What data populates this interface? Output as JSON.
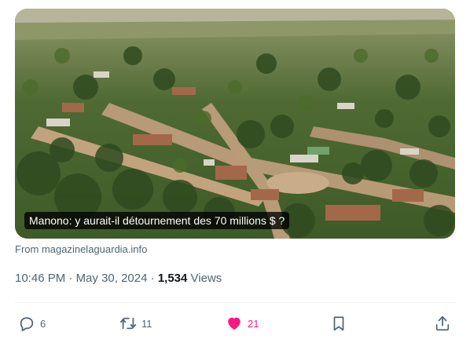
{
  "media": {
    "caption": "Manono: y aurait-il détournement des 70 millions $ ?",
    "source": "From magazinelaguardia.info"
  },
  "meta": {
    "time": "10:46 PM",
    "separator": "·",
    "date": "May 30, 2024",
    "views_count": "1,534",
    "views_label": "Views"
  },
  "actions": {
    "replies": "6",
    "reposts": "11",
    "likes": "21",
    "liked": true
  },
  "icons": {
    "reply": "reply-icon",
    "repost": "repost-icon",
    "like": "heart-icon",
    "bookmark": "bookmark-icon",
    "share": "share-icon"
  },
  "colors": {
    "like_active": "#f91880",
    "secondary_text": "#536471",
    "primary_text": "#0f1419"
  }
}
